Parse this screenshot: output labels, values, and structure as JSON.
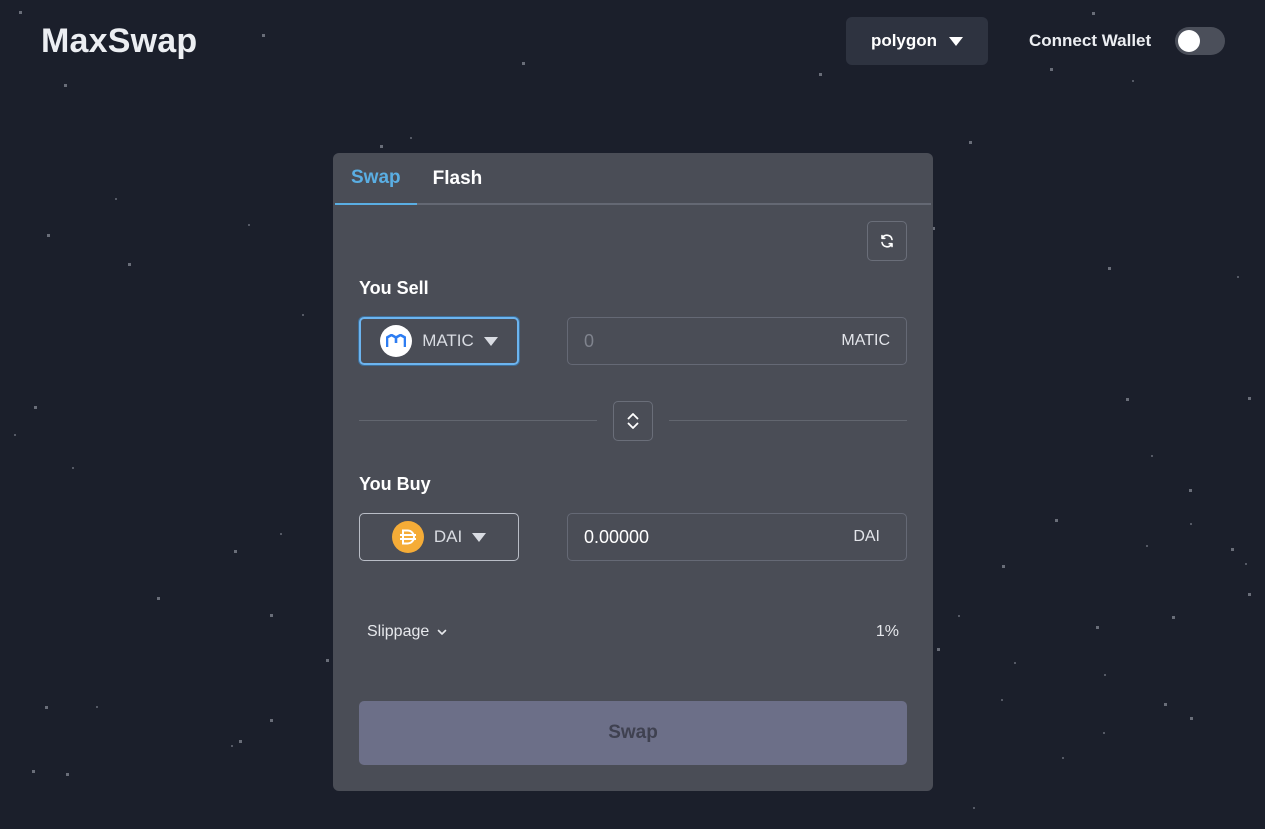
{
  "header": {
    "logo": "MaxSwap",
    "network": "polygon",
    "connect_wallet_label": "Connect Wallet",
    "wallet_connected": false
  },
  "tabs": [
    {
      "label": "Swap",
      "active": true
    },
    {
      "label": "Flash",
      "active": false
    }
  ],
  "sell": {
    "label": "You Sell",
    "token": "MATIC",
    "token_icon": "matic-token-icon",
    "amount_placeholder": "0",
    "amount_value": "",
    "unit": "MATIC"
  },
  "buy": {
    "label": "You Buy",
    "token": "DAI",
    "token_icon": "dai-token-icon",
    "amount_value": "0.00000",
    "unit": "DAI"
  },
  "slippage": {
    "label": "Slippage",
    "value": "1%"
  },
  "swap_button_label": "Swap",
  "colors": {
    "background": "#1b1f2b",
    "card": "#4a4d56",
    "active_tab": "#5aaee3",
    "swap_button": "#6c6f88",
    "matic": "#2e7df2",
    "dai": "#f5ac37"
  }
}
